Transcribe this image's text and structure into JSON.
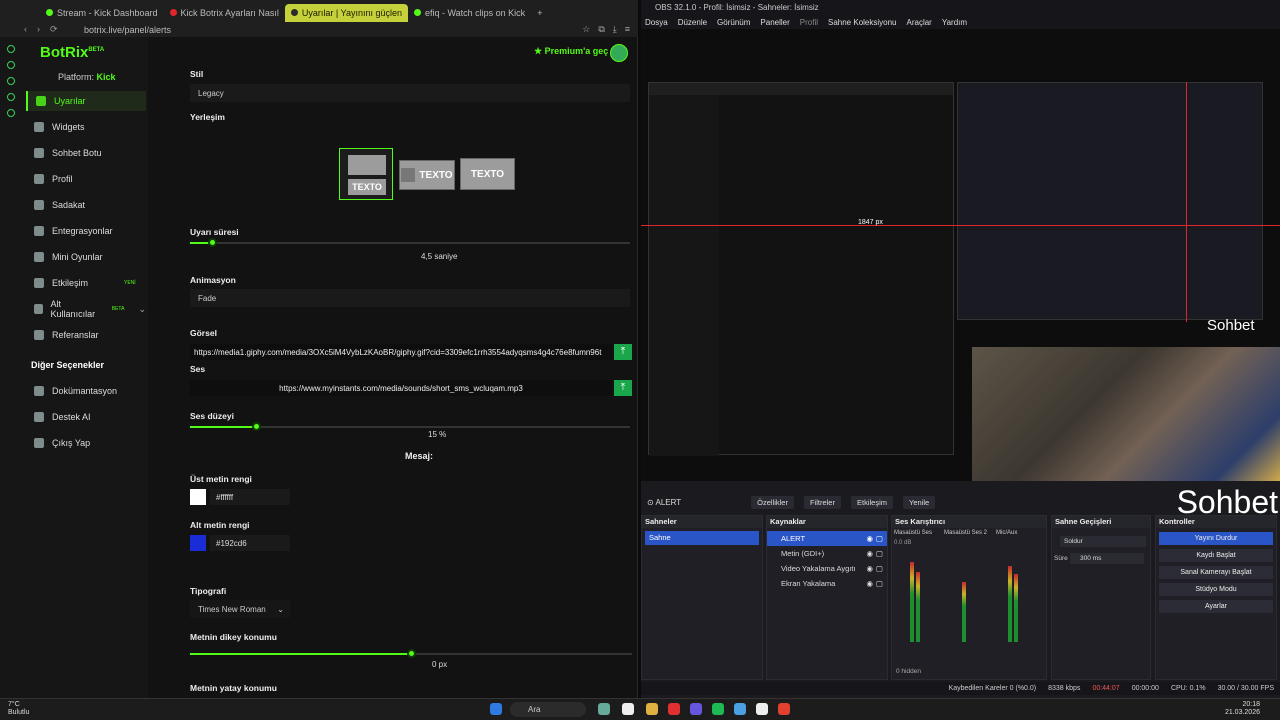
{
  "browser": {
    "tabs": [
      {
        "label": "Stream - Kick Dashboard",
        "color": "#53fc18"
      },
      {
        "label": "Kick Botrix Ayarları Nasıl",
        "color": "#e0262c"
      },
      {
        "label": "Uyarılar | Yayınını güçlen",
        "color": "#53fc18",
        "active": true
      },
      {
        "label": "efiq - Watch clips on Kick",
        "color": "#53fc18"
      }
    ],
    "url": "botrix.live/panel/alerts"
  },
  "app": {
    "logo": "BotRix",
    "logo_badge": "BETA",
    "platform_label": "Platform:",
    "platform_value": "Kick",
    "premium": "Premium'a geç"
  },
  "sidebar": {
    "items": [
      {
        "label": "Uyarılar",
        "icon": "warning-icon",
        "active": true
      },
      {
        "label": "Widgets",
        "icon": "widgets-icon"
      },
      {
        "label": "Sohbet Botu",
        "icon": "chatbot-icon"
      },
      {
        "label": "Profil",
        "icon": "profile-icon"
      },
      {
        "label": "Sadakat",
        "icon": "trophy-icon"
      },
      {
        "label": "Entegrasyonlar",
        "icon": "integrations-icon"
      },
      {
        "label": "Mini Oyunlar",
        "icon": "gamepad-icon"
      },
      {
        "label": "Etkileşim",
        "icon": "interaction-icon",
        "badge": "YENİ"
      },
      {
        "label": "Alt Kullanıcılar",
        "icon": "subusers-icon",
        "badge": "BETA"
      },
      {
        "label": "Referanslar",
        "icon": "referral-icon"
      }
    ],
    "other_heading": "Diğer Seçenekler",
    "other_items": [
      {
        "label": "Dokümantasyon",
        "icon": "docs-icon"
      },
      {
        "label": "Destek AI",
        "icon": "support-icon"
      },
      {
        "label": "Çıkış Yap",
        "icon": "logout-icon"
      }
    ]
  },
  "settings": {
    "style_label": "Stil",
    "style_value": "Legacy",
    "layout_label": "Yerleşim",
    "layout_text": "TEXTO",
    "duration_label": "Uyarı süresi",
    "duration_value": "4,5 saniye",
    "duration_fraction": 0.05,
    "animation_label": "Animasyon",
    "animation_value": "Fade",
    "image_label": "Görsel",
    "image_url": "https://media1.giphy.com/media/3OXc5iM4VybLzKAoBR/giphy.gif?cid=3309efc1rrh3554adyqsms4g4c76e8fumn96t",
    "sound_label": "Ses",
    "sound_url": "https://www.myinstants.com/media/sounds/short_sms_wcluqam.mp3",
    "volume_label": "Ses düzeyi",
    "volume_value": "15 %",
    "volume_fraction": 0.15,
    "message_label": "Mesaj:",
    "top_color_label": "Üst metin rengi",
    "top_color_value": "#ffffff",
    "bottom_color_label": "Alt metin rengi",
    "bottom_color_value": "#192cd6",
    "typography_label": "Tipografi",
    "typography_value": "Times New Roman",
    "vertical_label": "Metnin dikey konumu",
    "vertical_value": "0 px",
    "vertical_fraction": 0.5,
    "horizontal_label": "Metnin yatay konumu"
  },
  "obs": {
    "title": "OBS 32.1.0 - Profil: İsimsiz - Sahneler: İsimsiz",
    "menu": [
      "Dosya",
      "Düzenle",
      "Görünüm",
      "Paneller",
      "Profil",
      "Sahne Koleksiyonu",
      "Araçlar",
      "Yardım"
    ],
    "preview_overlay": "Sohbet",
    "preview_overlay_small": "Sohbet",
    "preview_dim": "1847 px",
    "selected_source": "ALERT",
    "source_buttons": [
      "Özellikler",
      "Filtreler",
      "Etkileşim",
      "Yenile"
    ],
    "docks": {
      "scenes": {
        "title": "Sahneler",
        "items": [
          "Sahne"
        ]
      },
      "sources": {
        "title": "Kaynaklar",
        "items": [
          "ALERT",
          "Metin (GDI+)",
          "Video Yakalama Aygıtı",
          "Ekran Yakalama"
        ]
      },
      "mixer": {
        "title": "Ses Karıştırıcı",
        "channels": [
          "Masaüstü Ses",
          "Masaüstü Ses 2",
          "Mic/Aux"
        ],
        "level": "0.0 dB",
        "hidden": "0 hidden"
      },
      "transitions": {
        "title": "Sahne Geçişleri",
        "value": "Soldur",
        "duration_label": "Süre",
        "duration": "300 ms"
      },
      "controls": {
        "title": "Kontroller",
        "buttons": [
          "Yayını Durdur",
          "Kaydı Başlat",
          "Sanal Kamerayı Başlat",
          "Stüdyo Modu",
          "Ayarlar"
        ]
      }
    },
    "status": {
      "dropped": "Kaybedilen Kareler 0 (%0.0)",
      "bitrate": "8338 kbps",
      "live": "00:44:07",
      "rec": "00:00:00",
      "cpu": "CPU: 0.1%",
      "fps": "30.00 / 30.00 FPS"
    }
  },
  "taskbar": {
    "weather_temp": "7°C",
    "weather_desc": "Bulutlu",
    "search": "Ara",
    "time": "20:18",
    "date": "21.03.2026"
  }
}
